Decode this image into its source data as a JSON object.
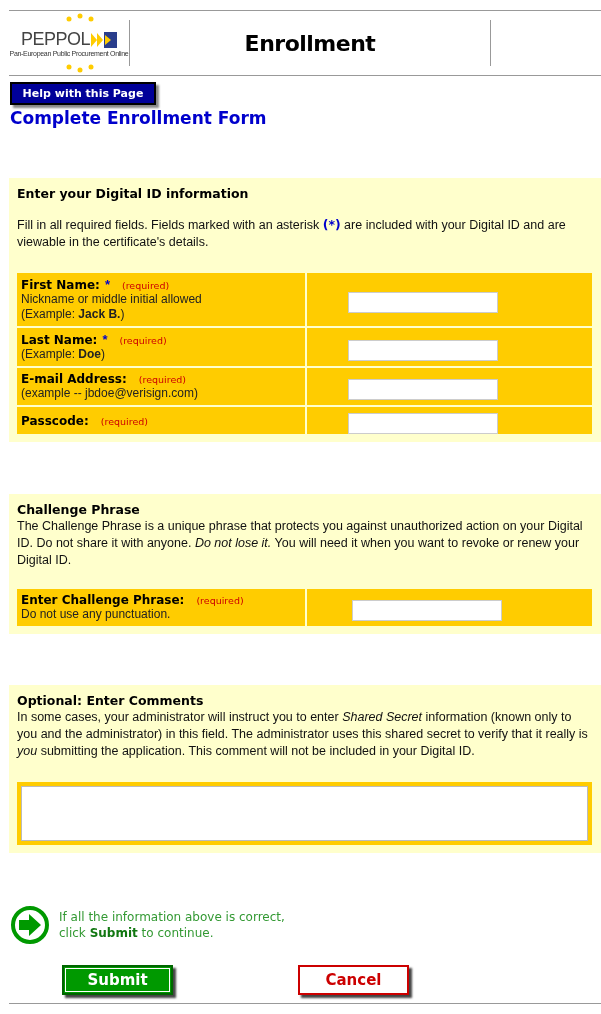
{
  "header": {
    "logo_text": "PEPPOL",
    "logo_subtitle": "Pan-European Public Procurement Online",
    "title": "Enrollment"
  },
  "help_button": "Help with this Page",
  "page_title": "Complete Enrollment Form",
  "sections": [
    {
      "kind": "fields",
      "heading": "Enter your Digital ID information",
      "intro": "Fill in all required fields. Fields marked with an asterisk **(*)** are included with your Digital ID and are viewable in the certificate's details.",
      "rows": [
        {
          "label": "First Name:",
          "asterisk": "*",
          "required": "(required)",
          "hints": [
            "Nickname or middle initial allowed",
            "(Example: **Jack B.**)"
          ]
        },
        {
          "label": "Last Name:",
          "asterisk": "*",
          "required": "(required)",
          "hints": [
            "(Example: **Doe**)"
          ]
        },
        {
          "label": "E-mail Address:",
          "required": "(required)",
          "hints": [
            "(example -- jbdoe@verisign.com)"
          ]
        },
        {
          "label": "Passcode:",
          "required": "(required)",
          "hints": []
        }
      ]
    },
    {
      "kind": "fields",
      "heading": "Challenge Phrase",
      "intro": "The Challenge Phrase is a unique phrase that protects you against unauthorized action on your Digital ID. Do not share it with anyone. *Do not lose it.* You will need it when you want to revoke or renew your Digital ID.",
      "rows": [
        {
          "label": "Enter Challenge Phrase:",
          "required": "(required)",
          "hints": [
            "Do not use any punctuation."
          ]
        }
      ]
    },
    {
      "kind": "comments",
      "heading": "Optional: Enter Comments",
      "intro": "In some cases, your administrator will instruct you to enter *Shared Secret* information (known only to you and the administrator) in this field. The administrator uses this shared secret to verify that it really is *you* submitting the application. This comment will not be included in your Digital ID."
    }
  ],
  "footer": {
    "message_lines": [
      "If all the information above is correct,",
      "click **Submit** to continue."
    ],
    "submit": "Submit",
    "cancel": "Cancel"
  }
}
